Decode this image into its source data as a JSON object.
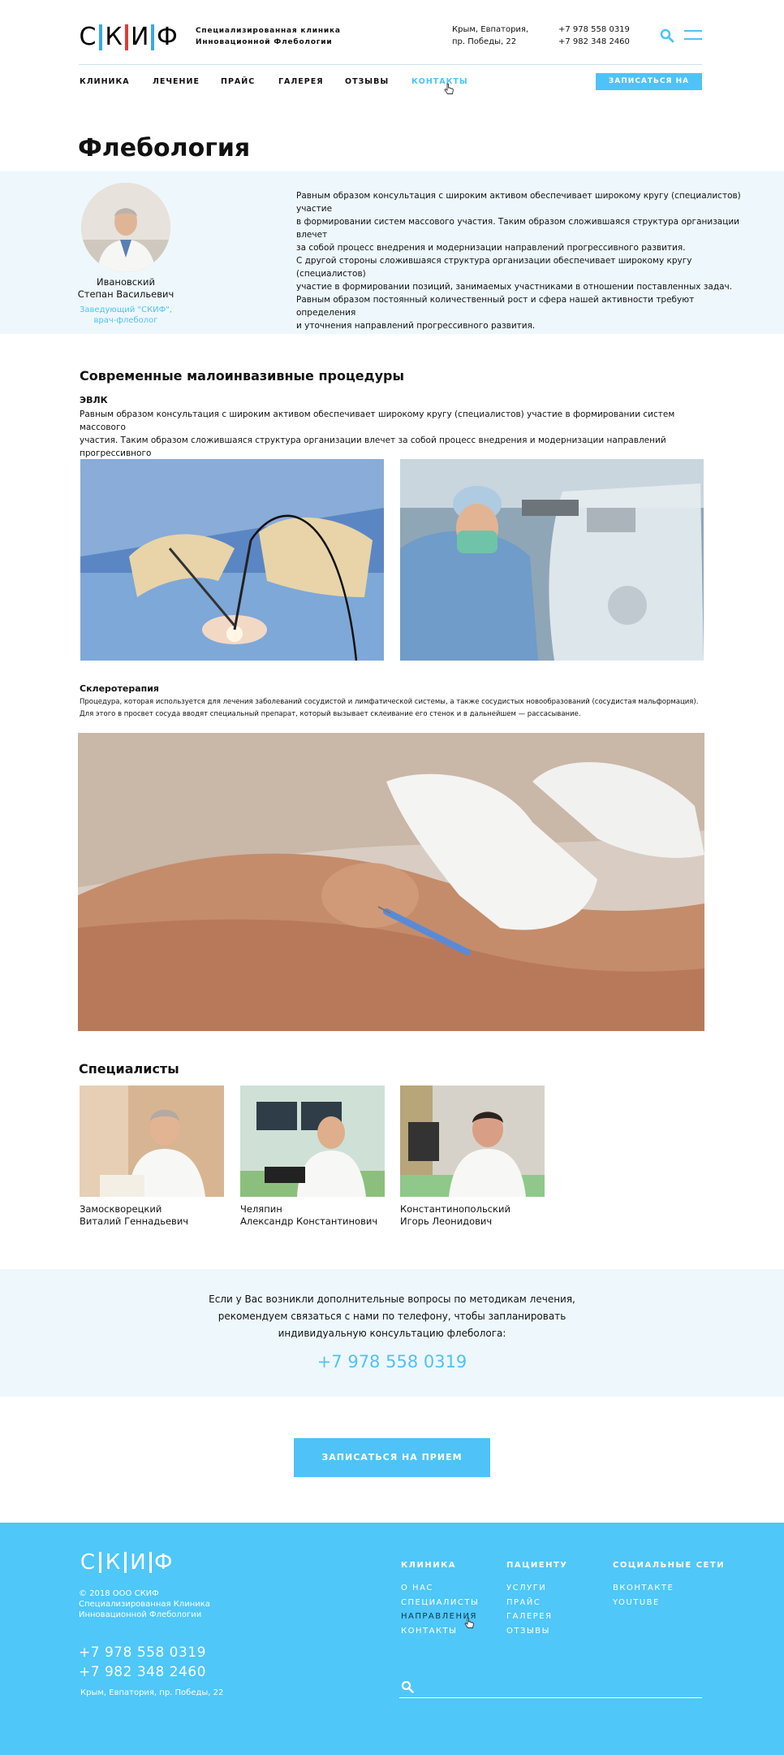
{
  "header": {
    "logo_letters": [
      "С",
      "К",
      "И",
      "Ф"
    ],
    "tagline_1": "Специализированная клиника",
    "tagline_2": "Инновационной Флебологии",
    "address_1": "Крым, Евпатория,",
    "address_2": "пр. Победы, 22",
    "phone_1": "+7 978 558 0319",
    "phone_2": "+7 982 348 2460",
    "icons": [
      "search-icon",
      "menu-icon"
    ]
  },
  "nav": {
    "items": [
      "Клиника",
      "Лечение",
      "Прайс",
      "Галерея",
      "Отзывы",
      "Контакты"
    ],
    "active": "Контакты",
    "cta": "Записаться на прием"
  },
  "page_title": "Флебология",
  "doctor": {
    "name_1": "Ивановский",
    "name_2": "Степан Васильевич",
    "role_1": "Заведующий \"СКИФ\",",
    "role_2": "врач-флеболог",
    "text": [
      "Равным образом консультация с широким активом обеспечивает широкому кругу (специалистов) участие",
      "в формировании систем массового участия. Таким образом сложившаяся структура организации влечет",
      "за собой процесс внедрения и модернизации направлений прогрессивного развития.",
      "С другой стороны сложившаяся структура организации обеспечивает широкому кругу (специалистов)",
      "участие в формировании позиций, занимаемых участниками в отношении поставленных задач.",
      "Равным образом постоянный количественный рост и сфера нашей активности требуют определения",
      "и уточнения направлений прогрессивного развития."
    ]
  },
  "procedures": {
    "title": "Современные малоинвазивные процедуры",
    "evlk_title": "ЭВЛК",
    "evlk_text": [
      "Равным образом консультация с широким активом обеспечивает широкому кругу (специалистов) участие в формировании систем массового",
      "участия. Таким образом сложившаяся структура организации влечет за собой процесс внедрения и модернизации направлений прогрессивного",
      "развития."
    ],
    "sclero_title": "Склеротерапия",
    "sclero_text": [
      "Процедура, которая используется для лечения заболеваний сосудистой и лимфатической системы, а также сосудистых новообразований (сосудистая мальформация).",
      "Для этого в просвет сосуда вводят специальный препарат, который вызывает склеивание его стенок и в дальнейшем — рассасывание."
    ]
  },
  "specialists": {
    "title": "Специалисты",
    "list": [
      {
        "name_1": "Замоскворецкий",
        "name_2": "Виталий Геннадьевич"
      },
      {
        "name_1": "Челяпин",
        "name_2": "Александр Константинович"
      },
      {
        "name_1": "Константинопольский",
        "name_2": "Игорь Леонидович"
      }
    ]
  },
  "contact_band": {
    "line_1": "Если у Вас возникли дополнительные вопросы по методикам лечения,",
    "line_2": "рекомендуем связаться с нами по телефону, чтобы запланировать",
    "line_3": "индивидуальную консультацию флеболога:",
    "phone": "+7 978 558 0319"
  },
  "cta_button": "Записаться на прием",
  "footer": {
    "copyright_1": "© 2018 ООО СКИФ",
    "copyright_2": "Специализированная Клиника",
    "copyright_3": "Инновационной Флебологии",
    "phone_1": "+7 978 558 0319",
    "phone_2": "+7 982 348 2460",
    "address": "Крым, Евпатория, пр. Победы, 22",
    "col1_title": "Клиника",
    "col1_items": [
      "О нас",
      "Специалисты",
      "Направления",
      "Контакты"
    ],
    "col2_title": "Пациенту",
    "col2_items": [
      "Услуги",
      "Прайс",
      "Галерея",
      "Отзывы"
    ],
    "col3_title": "Социальные сети",
    "col3_items": [
      "Вконтакте",
      "Youtube"
    ]
  },
  "colors": {
    "accent": "#4fc3f7",
    "band": "#eef8fc",
    "logo_blue": "#3aa8e6",
    "logo_red": "#e53935"
  }
}
